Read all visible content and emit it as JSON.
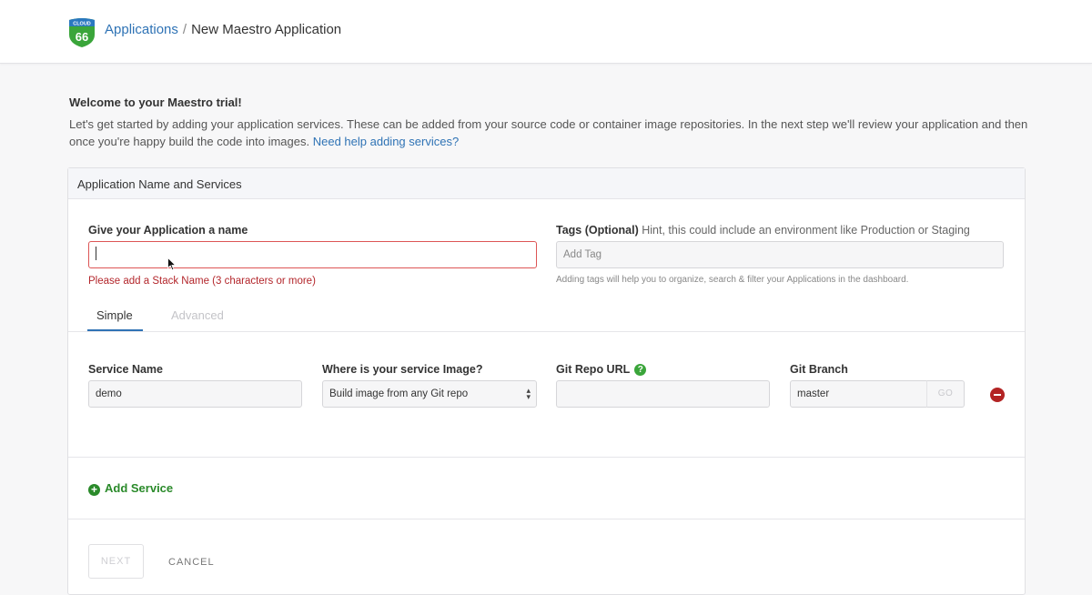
{
  "header": {
    "logo_text_top": "CLOUD",
    "logo_text_bottom": "66",
    "breadcrumb_link": "Applications",
    "breadcrumb_separator": "/",
    "breadcrumb_current": "New Maestro Application"
  },
  "intro": {
    "title": "Welcome to your Maestro trial!",
    "text": "Let's get started by adding your application services. These can be added from your source code or container image repositories. In the next step we'll review your application and then once you're happy build the code into images.",
    "help_link": "Need help adding services?"
  },
  "panel": {
    "title": "Application Name and Services",
    "app_name_label": "Give your Application a name",
    "app_name_value": "",
    "app_name_error": "Please add a Stack Name (3 characters or more)",
    "tags_label": "Tags (Optional)",
    "tags_hint": "Hint, this could include an environment like Production or Staging",
    "tags_placeholder": "Add Tag",
    "tags_help": "Adding tags will help you to organize, search & filter your Applications in the dashboard.",
    "tabs": [
      {
        "label": "Simple",
        "active": true
      },
      {
        "label": "Advanced",
        "active": false
      }
    ],
    "service": {
      "name_label": "Service Name",
      "name_value": "demo",
      "image_label": "Where is your service Image?",
      "image_value": "Build image from any Git repo",
      "git_url_label": "Git Repo URL",
      "git_url_value": "",
      "git_branch_label": "Git Branch",
      "git_branch_value": "master",
      "go_label": "GO"
    },
    "add_service_label": "Add Service",
    "next_label": "NEXT",
    "cancel_label": "CANCEL"
  },
  "colors": {
    "link": "#2f73b5",
    "error": "#b3262b",
    "success": "#2a8a2a",
    "logo_green": "#3aa53a",
    "logo_blue": "#2a78c0"
  }
}
